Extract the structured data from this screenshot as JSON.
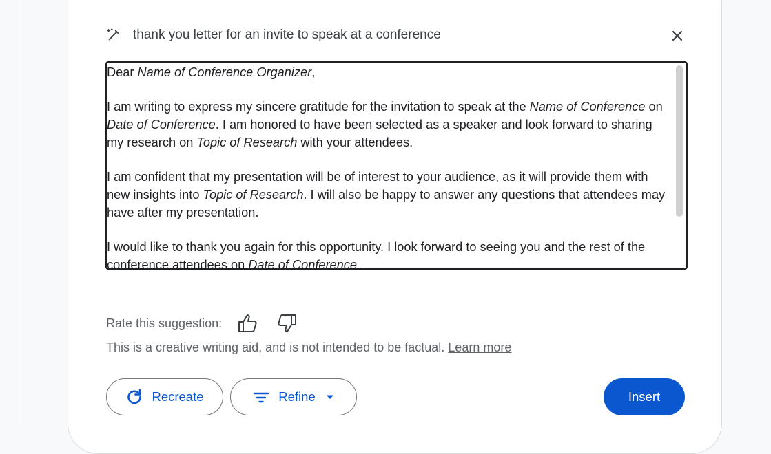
{
  "dialog": {
    "prompt": "thank you letter for an invite to speak at a conference",
    "icons": {
      "wand": "magic-wand-pencil-icon",
      "close": "close-icon"
    }
  },
  "letter": {
    "salutation": {
      "pre": "Dear ",
      "name": "Name of Conference Organizer",
      "post": ","
    },
    "p1": {
      "t1": "I am writing to express my sincere gratitude for the invitation to speak at the ",
      "i1": "Name of Conference",
      "t2": " on ",
      "i2": "Date of Conference",
      "t3": ". I am honored to have been selected as a speaker and look forward to sharing my research on ",
      "i3": "Topic of Research",
      "t4": " with your attendees."
    },
    "p2": {
      "t1": "I am confident that my presentation will be of interest to your audience, as it will provide them with new insights into ",
      "i1": "Topic of Research",
      "t2": ". I will also be happy to answer any questions that attendees may have after my presentation."
    },
    "p3": {
      "t1": "I would like to thank you again for this opportunity. I look forward to seeing you and the rest of the conference attendees on ",
      "i1": "Date of Conference",
      "t2": "."
    }
  },
  "feedback": {
    "rate_label": "Rate this suggestion:",
    "thumbs_up_icon": "thumbs-up-icon",
    "thumbs_down_icon": "thumbs-down-icon",
    "disclaimer": "This is a creative writing aid, and is not intended to be factual.",
    "learn_more": "Learn more"
  },
  "actions": {
    "recreate": "Recreate",
    "refine": "Refine",
    "insert": "Insert"
  },
  "colors": {
    "accent": "#0b57d0",
    "text": "#202124",
    "muted": "#5f6368"
  }
}
